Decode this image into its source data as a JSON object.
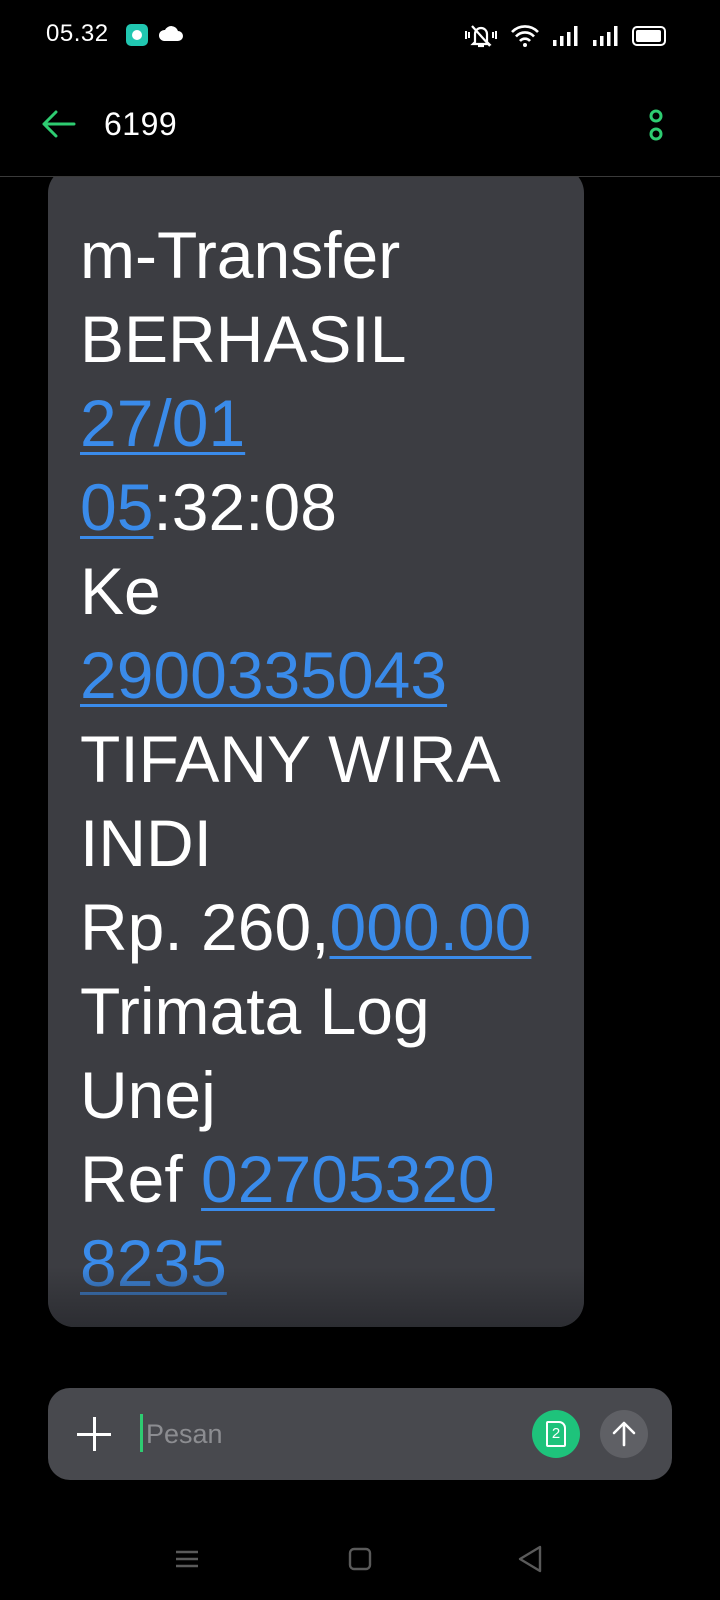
{
  "status_bar": {
    "time": "05.32",
    "battery_level": 0.95
  },
  "header": {
    "title": "6199"
  },
  "message": {
    "lines": [
      [
        {
          "text": "m-Transfer",
          "link": false
        }
      ],
      [
        {
          "text": "BERHASIL",
          "link": false
        }
      ],
      [
        {
          "text": "27/01",
          "link": true
        }
      ],
      [
        {
          "text": "05",
          "link": true
        },
        {
          "text": ":32:08",
          "link": false
        }
      ],
      [
        {
          "text": "Ke",
          "link": false
        }
      ],
      [
        {
          "text": "2900335043",
          "link": true
        }
      ],
      [
        {
          "text": "TIFANY WIRA",
          "link": false
        }
      ],
      [
        {
          "text": "INDI",
          "link": false
        }
      ],
      [
        {
          "text": "Rp. 260,",
          "link": false
        },
        {
          "text": "000.00",
          "link": true
        }
      ],
      [
        {
          "text": "Trimata Log",
          "link": false
        }
      ],
      [
        {
          "text": "Unej",
          "link": false
        }
      ],
      [
        {
          "text": "Ref ",
          "link": false
        },
        {
          "text": "02705320",
          "link": true
        }
      ],
      [
        {
          "text": "8235",
          "link": true
        }
      ]
    ]
  },
  "composer": {
    "placeholder": "Pesan",
    "sim_slot": "2"
  },
  "colors": {
    "accent_green": "#2ecc71",
    "link_blue": "#3a8bea",
    "bubble": "#3c3d42",
    "input_bar": "#48494e",
    "sim_button": "#1ec37b"
  },
  "icons": {
    "back": "arrow-left-icon",
    "menu": "more-vertical-icon",
    "add": "plus-icon",
    "sim": "sim-card-icon",
    "send": "arrow-up-icon",
    "nav_recent": "recent-apps-icon",
    "nav_home": "home-square-icon",
    "nav_back": "back-triangle-icon"
  }
}
